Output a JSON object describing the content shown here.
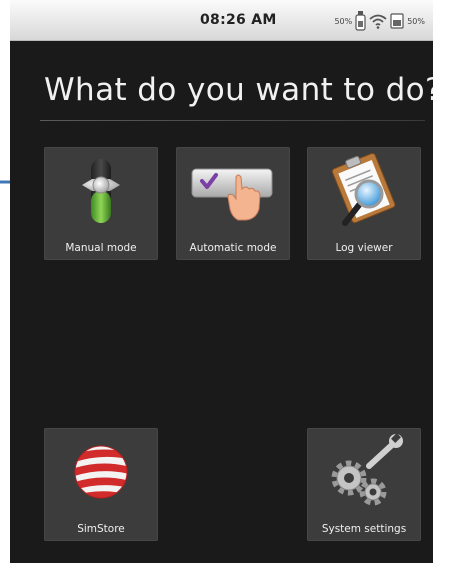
{
  "status_bar": {
    "time": "08:26 AM",
    "left_percent": "50%",
    "right_percent": "50%",
    "icons": [
      "usb-stick-icon",
      "wifi-icon",
      "battery-icon"
    ]
  },
  "heading": "What do you want to do?",
  "tiles": [
    {
      "label": "Manual mode",
      "icon": "slider-switch-icon"
    },
    {
      "label": "Automatic mode",
      "icon": "hand-pressing-button-icon"
    },
    {
      "label": "Log viewer",
      "icon": "clipboard-magnifier-icon"
    },
    {
      "label": "SimStore",
      "icon": "striped-globe-icon"
    },
    {
      "label": "System settings",
      "icon": "gears-wrench-icon"
    }
  ],
  "colors": {
    "background": "#1a1a1a",
    "tile": "#3c3c3c",
    "pointer_arrow": "#3f77b6"
  }
}
